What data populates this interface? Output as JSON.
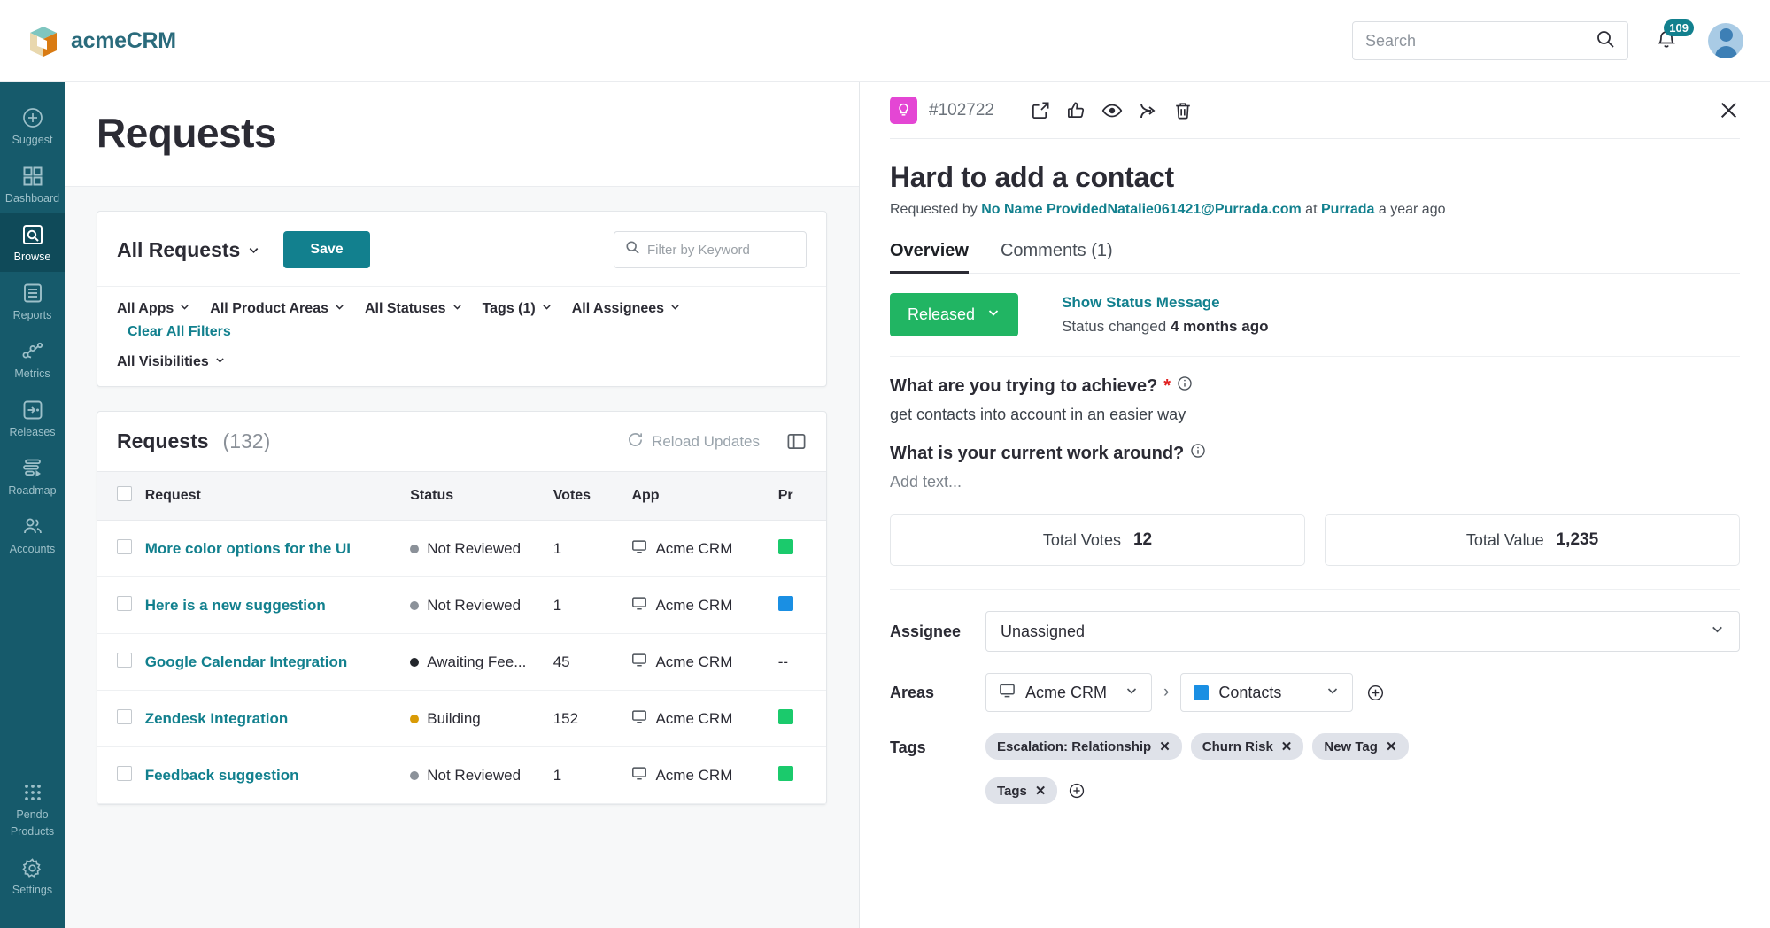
{
  "header": {
    "brand": "acmeCRM",
    "search_placeholder": "Search",
    "search_value": "",
    "notification_count": "109"
  },
  "sidebar": {
    "items": [
      {
        "label": "Suggest",
        "icon": "plus-circle-icon",
        "active": false
      },
      {
        "label": "Dashboard",
        "icon": "grid-icon",
        "active": false
      },
      {
        "label": "Browse",
        "icon": "browse-search-icon",
        "active": true
      },
      {
        "label": "Reports",
        "icon": "list-icon",
        "active": false
      },
      {
        "label": "Metrics",
        "icon": "metrics-graph-icon",
        "active": false
      },
      {
        "label": "Releases",
        "icon": "releases-icon",
        "active": false
      },
      {
        "label": "Roadmap",
        "icon": "roadmap-icon",
        "active": false
      },
      {
        "label": "Accounts",
        "icon": "people-icon",
        "active": false
      }
    ],
    "bottom_items": [
      {
        "label": "Pendo\nProducts",
        "label_line1": "Pendo",
        "label_line2": "Products",
        "icon": "apps-dots-icon"
      },
      {
        "label": "Settings",
        "icon": "gear-icon"
      }
    ]
  },
  "main": {
    "page_title": "Requests",
    "filters": {
      "view_name": "All Requests",
      "save_label": "Save",
      "keyword_placeholder": "Filter by Keyword",
      "keyword_value": "",
      "chips": [
        "All Apps",
        "All Product Areas",
        "All Statuses",
        "Tags (1)",
        "All Assignees"
      ],
      "clear_all_label": "Clear All Filters",
      "chips_row2": [
        "All Visibilities"
      ]
    },
    "table": {
      "title": "Requests",
      "count": "(132)",
      "reload_label": "Reload Updates",
      "columns": [
        "Request",
        "Status",
        "Votes",
        "App",
        "Pr"
      ],
      "rows": [
        {
          "request": "More color options for the UI",
          "status": "Not Reviewed",
          "status_color": "#8b9199",
          "votes": "1",
          "app": "Acme CRM",
          "pr_color": "#1bca6c"
        },
        {
          "request": "Here is a new suggestion",
          "status": "Not Reviewed",
          "status_color": "#8b9199",
          "votes": "1",
          "app": "Acme CRM",
          "pr_color": "#1a8fe3"
        },
        {
          "request": "Google Calendar Integration",
          "status": "Awaiting Fee...",
          "status_color": "#23262c",
          "votes": "45",
          "app": "Acme CRM",
          "pr_color": "",
          "pr_text": "--"
        },
        {
          "request": "Zendesk Integration",
          "status": "Building",
          "status_color": "#d99b06",
          "votes": "152",
          "app": "Acme CRM",
          "pr_color": "#1bca6c"
        },
        {
          "request": "Feedback suggestion",
          "status": "Not Reviewed",
          "status_color": "#8b9199",
          "votes": "1",
          "app": "Acme CRM",
          "pr_color": "#1bca6c"
        }
      ]
    }
  },
  "panel": {
    "request_id": "#102722",
    "actions": [
      {
        "icon": "external-link-icon",
        "name": "open-external"
      },
      {
        "icon": "thumbs-up-icon",
        "name": "vote"
      },
      {
        "icon": "eye-icon",
        "name": "watch"
      },
      {
        "icon": "merge-icon",
        "name": "merge"
      },
      {
        "icon": "trash-icon",
        "name": "delete"
      }
    ],
    "title": "Hard to add a contact",
    "requested_by_prefix": "Requested by",
    "requester": "No Name ProvidedNatalie061421@Purrada.com",
    "at_word": "at",
    "account": "Purrada",
    "time_ago": "a year ago",
    "tabs": [
      {
        "label": "Overview",
        "active": true
      },
      {
        "label": "Comments (1)",
        "active": false
      }
    ],
    "status": {
      "value": "Released",
      "color": "#21b563",
      "show_message_label": "Show Status Message",
      "changed_prefix": "Status changed",
      "changed_time": "4 months ago"
    },
    "questions": [
      {
        "label": "What are you trying to achieve?",
        "required": true,
        "answer": "get contacts into account in an easier way",
        "is_placeholder": false
      },
      {
        "label": "What is your current work around?",
        "required": false,
        "answer": "Add text...",
        "is_placeholder": true
      }
    ],
    "stats": [
      {
        "label": "Total Votes",
        "value": "12"
      },
      {
        "label": "Total Value",
        "value": "1,235"
      }
    ],
    "assignee": {
      "label": "Assignee",
      "value": "Unassigned"
    },
    "areas": {
      "label": "Areas",
      "app": "Acme CRM",
      "area": "Contacts",
      "area_color": "#1a8fe3"
    },
    "tags": {
      "label": "Tags",
      "items": [
        "Escalation: Relationship",
        "Churn Risk",
        "New Tag",
        "Tags"
      ]
    }
  }
}
